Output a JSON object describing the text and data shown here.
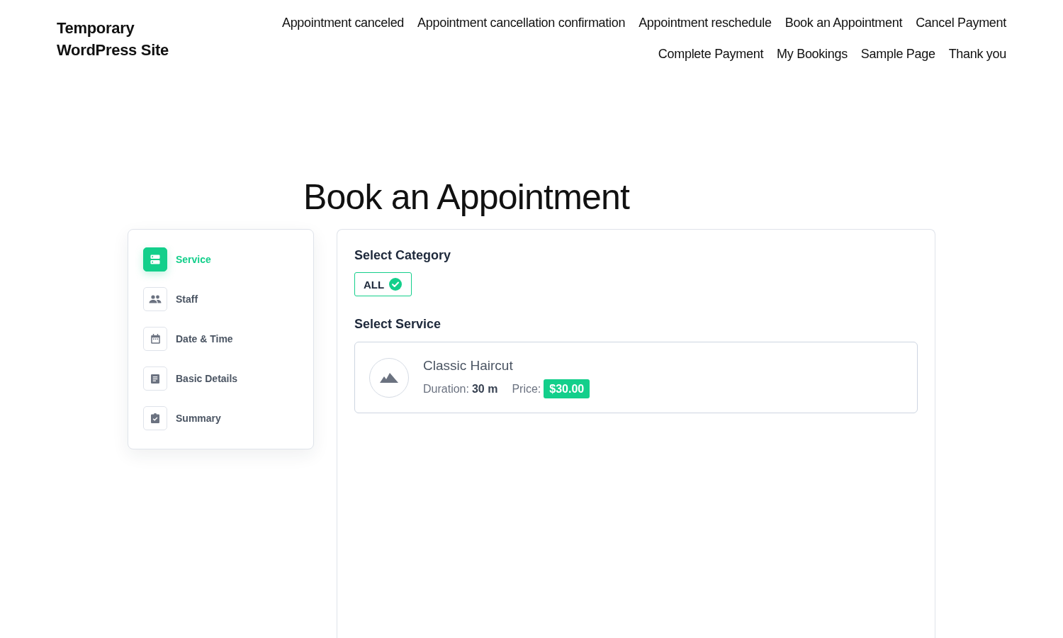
{
  "site_title": "Temporary WordPress Site",
  "nav": [
    {
      "label": "Appointment canceled"
    },
    {
      "label": "Appointment cancellation confirmation"
    },
    {
      "label": "Appointment reschedule"
    },
    {
      "label": "Book an Appointment"
    },
    {
      "label": "Cancel Payment"
    },
    {
      "label": "Complete Payment"
    },
    {
      "label": "My Bookings"
    },
    {
      "label": "Sample Page"
    },
    {
      "label": "Thank you"
    }
  ],
  "page_title": "Book an Appointment",
  "steps": [
    {
      "label": "Service",
      "selected": true
    },
    {
      "label": "Staff",
      "selected": false
    },
    {
      "label": "Date & Time",
      "selected": false
    },
    {
      "label": "Basic Details",
      "selected": false
    },
    {
      "label": "Summary",
      "selected": false
    }
  ],
  "category": {
    "heading": "Select Category",
    "options": [
      {
        "label": "ALL",
        "selected": true
      }
    ]
  },
  "service_section": {
    "heading": "Select Service",
    "services": [
      {
        "name": "Classic Haircut",
        "duration_label": "Duration:",
        "duration": "30 m",
        "price_label": "Price:",
        "price": "$30.00"
      }
    ]
  }
}
